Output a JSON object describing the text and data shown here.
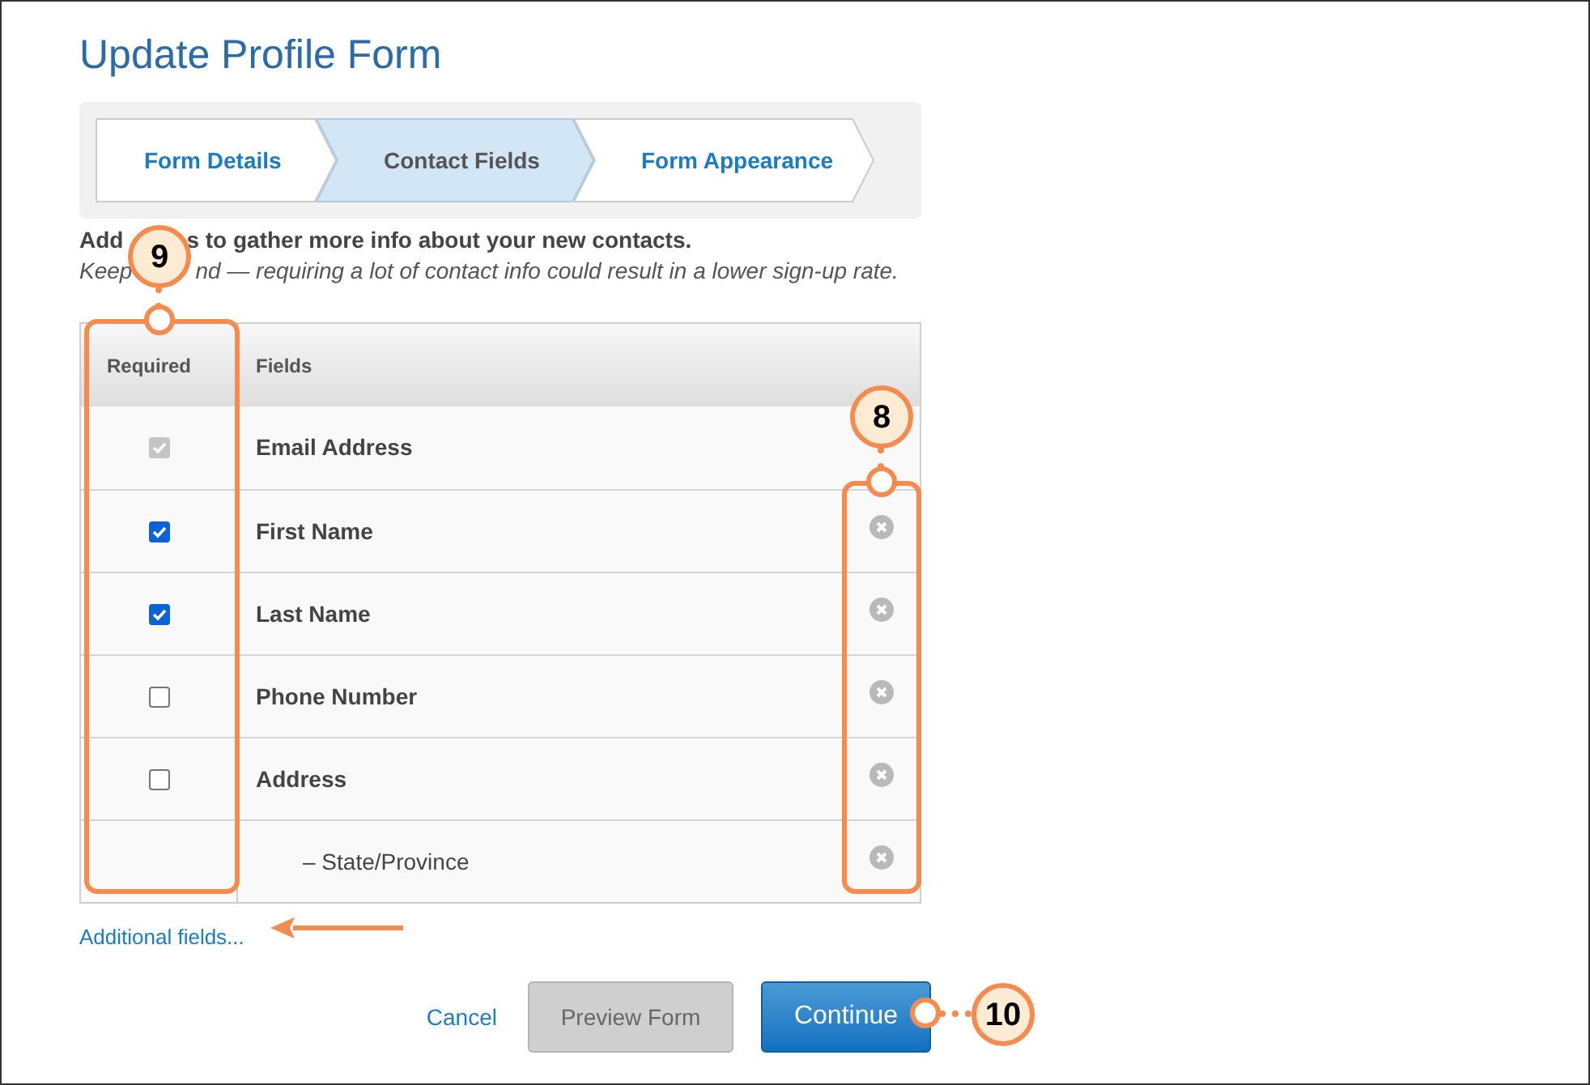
{
  "title": "Update Profile Form",
  "steps": [
    {
      "label": "Form Details",
      "selected": false
    },
    {
      "label": "Contact Fields",
      "selected": true
    },
    {
      "label": "Form Appearance",
      "selected": false
    }
  ],
  "intro": {
    "line_1": [
      "Add",
      "s to gather more info about your new contacts."
    ],
    "line_2": [
      "Keep",
      "nd — requiring a lot of contact info could result in a lower sign-up rate."
    ]
  },
  "table": {
    "columns": [
      "Required",
      "Fields"
    ],
    "rows": [
      {
        "field": "Email Address",
        "required": true,
        "disabled": true,
        "removable": false
      },
      {
        "field": "First Name",
        "required": true,
        "disabled": false,
        "removable": true
      },
      {
        "field": "Last Name",
        "required": true,
        "disabled": false,
        "removable": true
      },
      {
        "field": "Phone Number",
        "required": false,
        "disabled": false,
        "removable": true
      },
      {
        "field": "Address",
        "required": false,
        "disabled": false,
        "removable": true,
        "children": [
          {
            "field": "– State/Province",
            "removable": true
          }
        ]
      }
    ]
  },
  "additional_link": "Additional fields...",
  "buttons": {
    "cancel": "Cancel",
    "preview": "Preview Form",
    "continue": "Continue"
  },
  "callouts": [
    "9",
    "8",
    "10"
  ]
}
